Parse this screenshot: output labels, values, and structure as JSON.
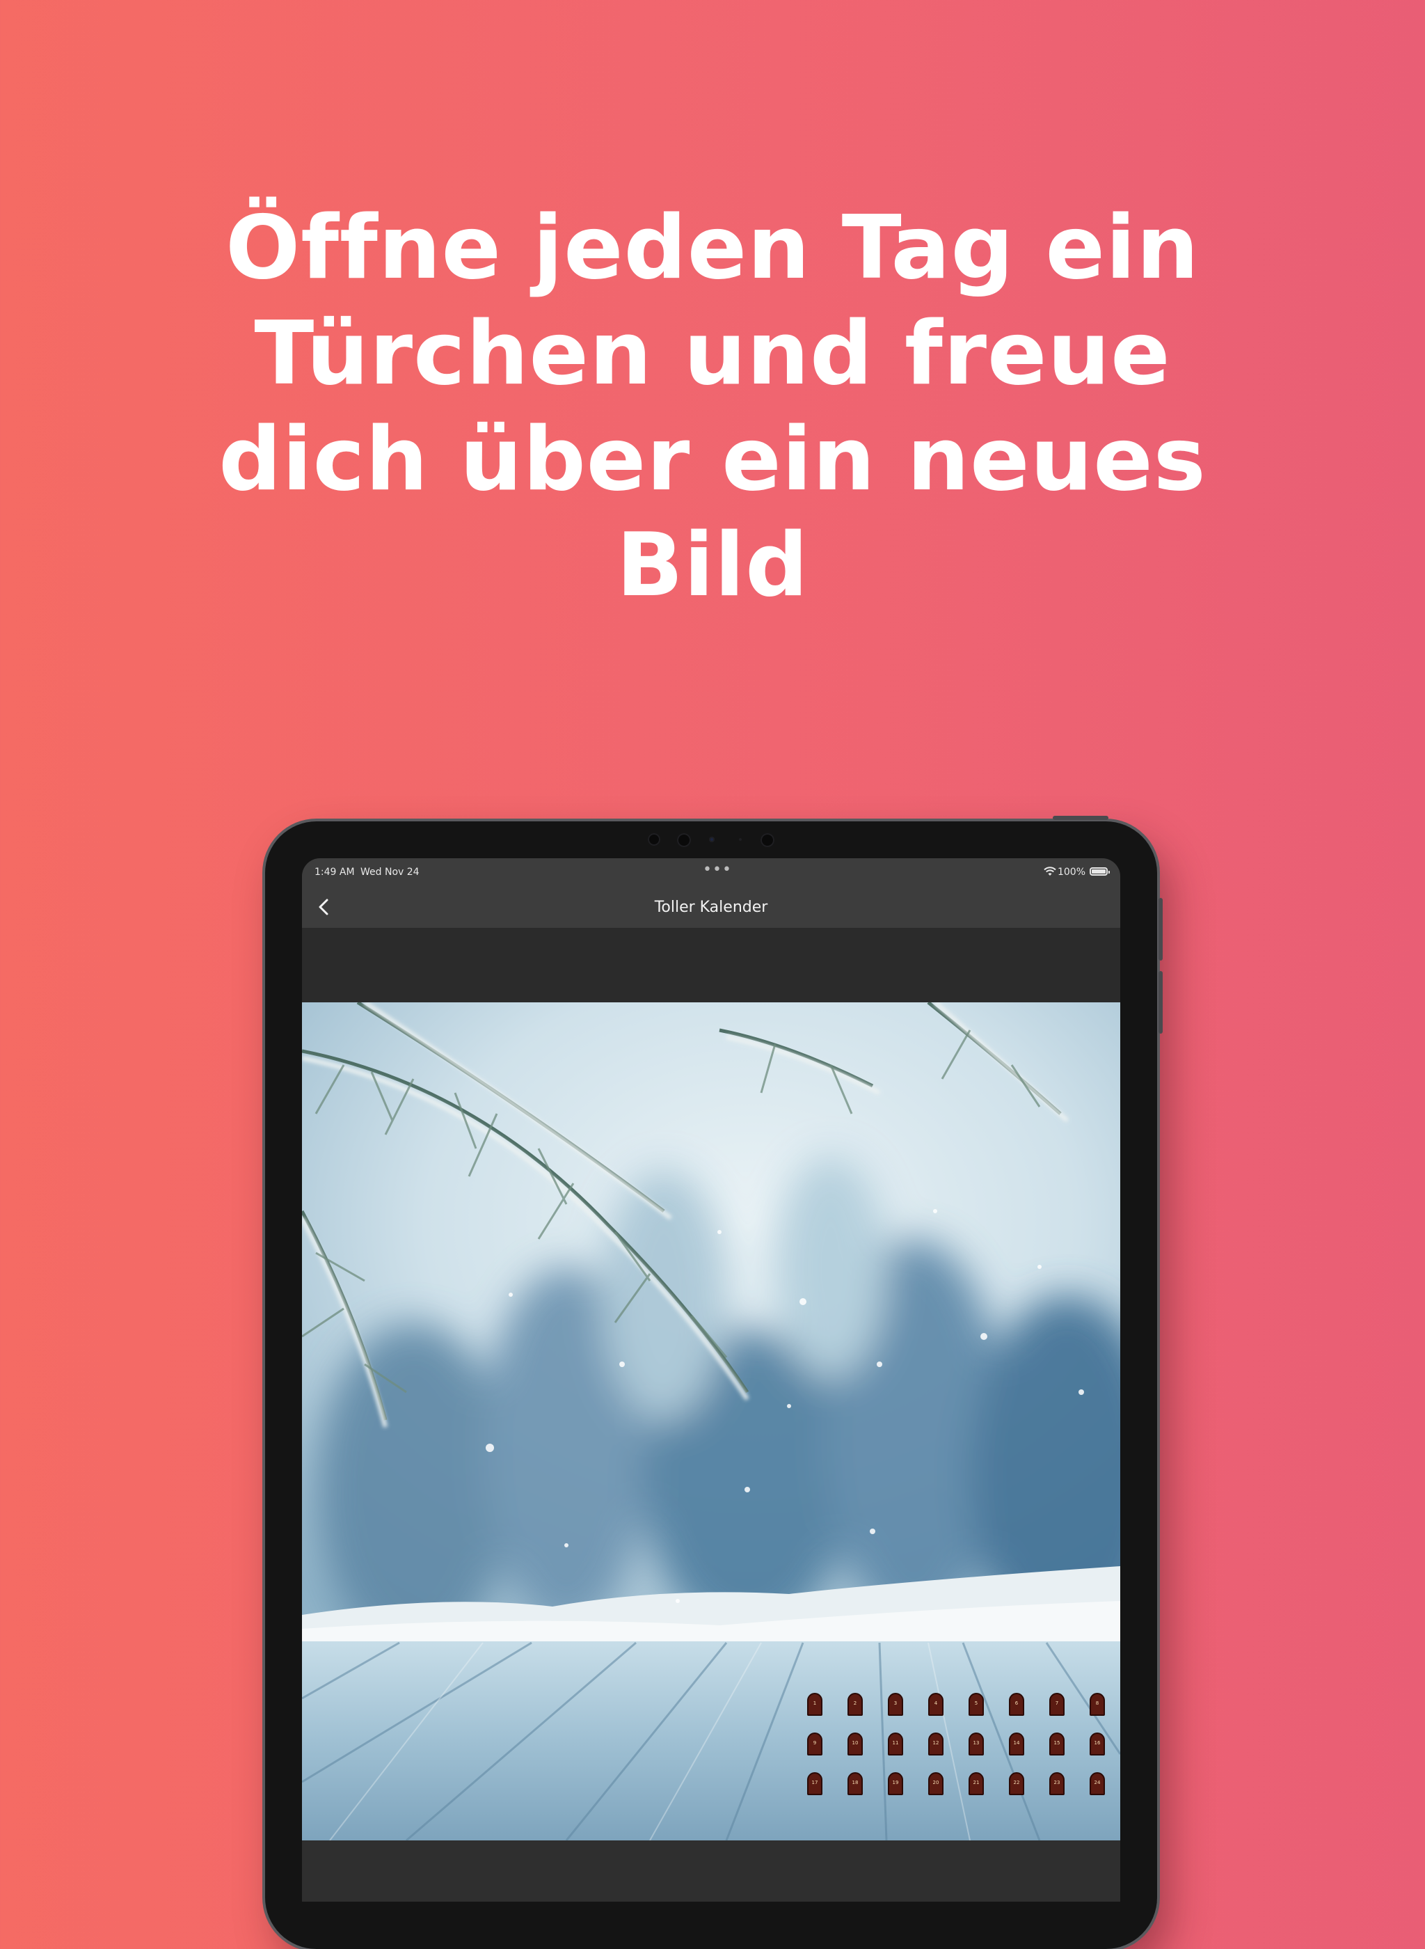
{
  "headline": [
    "Öffne jeden Tag ein",
    "Türchen und freue",
    "dich über ein neues",
    "Bild"
  ],
  "status_bar": {
    "time": "1:49 AM",
    "date": "Wed Nov 24",
    "battery": "100%"
  },
  "nav": {
    "title": "Toller Kalender",
    "back_icon": "chevron-left-icon"
  },
  "calendar": {
    "image": "snowy fir branch over wooden table",
    "doors": [
      1,
      2,
      3,
      4,
      5,
      6,
      7,
      8,
      9,
      10,
      11,
      12,
      13,
      14,
      15,
      16,
      17,
      18,
      19,
      20,
      21,
      22,
      23,
      24
    ],
    "door_color": "#5b1b12"
  },
  "colors": {
    "background_left": "#f56b64",
    "background_right": "#e95e75",
    "bar": "#3d3d3d"
  }
}
